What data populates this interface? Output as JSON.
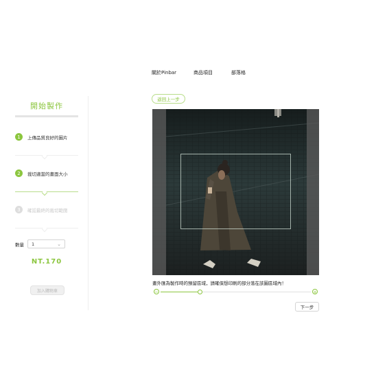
{
  "nav": [
    {
      "label": "關於Pinbar"
    },
    {
      "label": "商品項目"
    },
    {
      "label": "部落格"
    }
  ],
  "sidebar": {
    "title": "開始製作",
    "steps": [
      {
        "number": "1",
        "label": "上傳品質良好的圖片",
        "state": "done"
      },
      {
        "number": "2",
        "label": "裁切適當的畫面大小",
        "state": "active"
      },
      {
        "number": "3",
        "label": "確認最終的裁切範圍",
        "state": "inactive"
      }
    ],
    "quantity_label": "數量",
    "quantity_value": "1",
    "price": "NT.170",
    "add_to_cart": "加入購物車"
  },
  "editor": {
    "back_label": "返回上一步",
    "hint": "畫外匯為製作時的預留區域，請確保想印刷的部分落在該圖區域內！",
    "zoom_level": 0.26,
    "next_label": "下一步"
  },
  "colors": {
    "accent": "#8cc63f",
    "accent_light": "#b8dd8a",
    "inactive": "#c8c8c8"
  },
  "icons": {
    "zoom_out": "minus-circle-icon",
    "zoom_in": "plus-circle-icon",
    "dropdown": "chevron-down-icon"
  }
}
